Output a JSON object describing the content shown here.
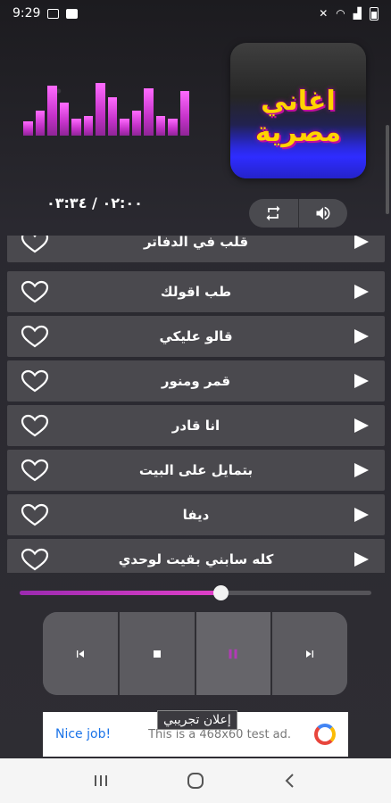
{
  "status_bar": {
    "time": "9:29",
    "right_icons": [
      "mute-icon",
      "wifi-icon",
      "signal-icon",
      "battery-icon"
    ]
  },
  "equalizer": {
    "levels": [
      0.25,
      0.45,
      0.9,
      0.6,
      0.3,
      0.35,
      0.95,
      0.7,
      0.3,
      0.45,
      0.85,
      0.35,
      0.3,
      0.8
    ]
  },
  "album": {
    "title": "اغاني مصرية"
  },
  "player": {
    "time_display": "٠٢:٠٠ / ٠٣:٣٤",
    "progress": 0.57
  },
  "songs": [
    {
      "title": "قلب في الدفاتر"
    },
    {
      "title": "طب اقولك"
    },
    {
      "title": "قالو عليكي"
    },
    {
      "title": "قمر ومنور"
    },
    {
      "title": "انا قادر"
    },
    {
      "title": "بتمايل على البيت"
    },
    {
      "title": "ديفا"
    },
    {
      "title": "كله سابني بقيت لوحدي"
    }
  ],
  "ad": {
    "label": "إعلان تجريبي",
    "nice": "Nice job!",
    "text": "This is a 468x60 test ad."
  },
  "colors": {
    "accent": "#c432c9",
    "row_bg": "#4a494e"
  }
}
